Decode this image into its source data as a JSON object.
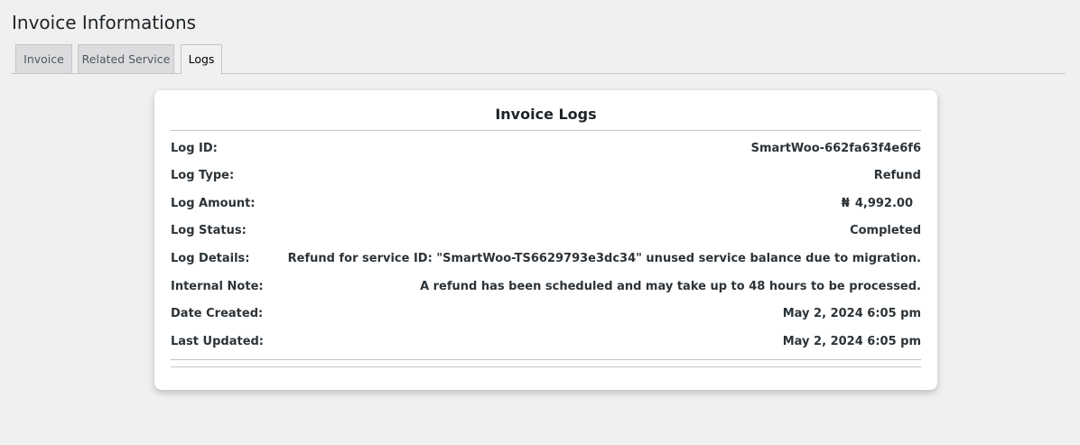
{
  "page": {
    "title": "Invoice Informations"
  },
  "tabs": [
    {
      "label": "Invoice",
      "active": false
    },
    {
      "label": "Related Service",
      "active": false
    },
    {
      "label": "Logs",
      "active": true
    }
  ],
  "card": {
    "title": "Invoice Logs",
    "rows": [
      {
        "label": "Log ID:",
        "value": "SmartWoo-662fa63f4e6f6"
      },
      {
        "label": "Log Type:",
        "value": "Refund"
      },
      {
        "label": "Log Amount:",
        "currency_symbol": "₦",
        "value": "4,992.00"
      },
      {
        "label": "Log Status:",
        "value": "Completed"
      },
      {
        "label": "Log Details:",
        "value": "Refund for service ID: \"SmartWoo-TS6629793e3dc34\" unused service balance due to migration."
      },
      {
        "label": "Internal Note:",
        "value": "A refund has been scheduled and may take up to 48 hours to be processed."
      },
      {
        "label": "Date Created:",
        "value": "May 2, 2024 6:05 pm"
      },
      {
        "label": "Last Updated:",
        "value": "May 2, 2024 6:05 pm"
      }
    ]
  },
  "colors": {
    "background": "#f0f0f1",
    "card": "#ffffff",
    "tab_inactive": "#dcdcde",
    "border": "#c3c4c7",
    "text": "#1d2327"
  }
}
